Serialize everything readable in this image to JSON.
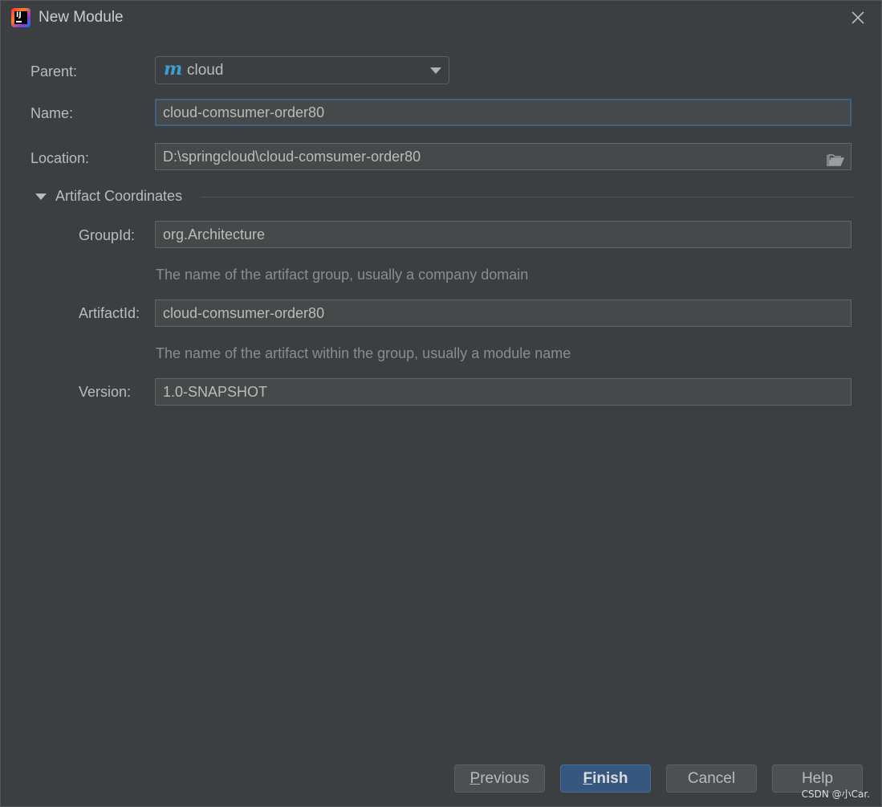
{
  "window": {
    "title": "New Module",
    "app_logo_text": "IJ"
  },
  "form": {
    "parent": {
      "label": "Parent:",
      "value": "cloud",
      "icon": "maven-m-icon"
    },
    "name": {
      "label": "Name:",
      "value": "cloud-comsumer-order80"
    },
    "location": {
      "label": "Location:",
      "value": "D:\\springcloud\\cloud-comsumer-order80",
      "icon": "folder-icon"
    }
  },
  "artifact": {
    "section_title": "Artifact Coordinates",
    "expanded": true,
    "group_id": {
      "label": "GroupId:",
      "value": "org.Architecture",
      "hint": "The name of the artifact group, usually a company domain"
    },
    "artifact_id": {
      "label": "ArtifactId:",
      "value": "cloud-comsumer-order80",
      "hint": "The name of the artifact within the group, usually a module name"
    },
    "version": {
      "label": "Version:",
      "value": "1.0-SNAPSHOT"
    }
  },
  "buttons": {
    "previous": {
      "mnemonic": "P",
      "rest": "revious"
    },
    "finish": {
      "mnemonic": "F",
      "rest": "inish"
    },
    "cancel": {
      "label": "Cancel"
    },
    "help": {
      "label": "Help"
    }
  },
  "watermark": "CSDN @小Car.",
  "colors": {
    "background": "#3c3f41",
    "field_background": "#45494a",
    "focus_border": "#3d6185",
    "primary_button": "#365880",
    "maven_icon": "#3e9fd8"
  }
}
